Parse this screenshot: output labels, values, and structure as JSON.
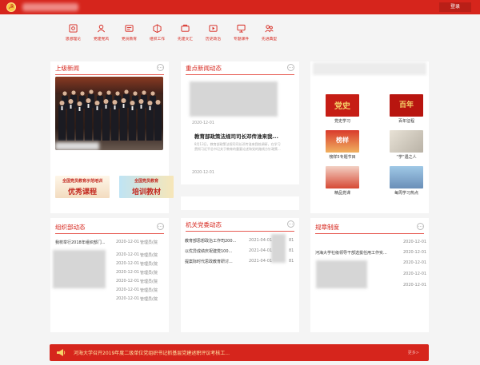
{
  "header": {
    "logo_icon": "party-emblem-icon",
    "login_label": "登录"
  },
  "nav": [
    {
      "label": "思想理论",
      "icon": "theory-icon"
    },
    {
      "label": "党建党风",
      "icon": "people-icon"
    },
    {
      "label": "党员教育",
      "icon": "education-icon"
    },
    {
      "label": "组织工作",
      "icon": "organization-icon"
    },
    {
      "label": "先建文汇",
      "icon": "culture-icon"
    },
    {
      "label": "历史政治",
      "icon": "history-icon"
    },
    {
      "label": "专题课件",
      "icon": "courseware-icon"
    },
    {
      "label": "先进典型",
      "icon": "model-icon"
    }
  ],
  "upper_news": {
    "title": "上级新闻",
    "banners": [
      {
        "line1": "全国党员教育示范培训",
        "line2": "优秀课程"
      },
      {
        "line1": "全国党员教育",
        "line2": "培训教材"
      }
    ]
  },
  "key_news": {
    "title": "重点新闻动态",
    "date_top": "2020-12-01",
    "headline": "教育部政策法规司司长邓传淮来我...",
    "summary": "8月13日，教育部政策法规司司长邓传淮来我校调研，在学习贯彻习近平总书记关于教育的重要论述和党的路线方针政策...",
    "date_bottom": "2020-12-01"
  },
  "topics": [
    {
      "label": "党史学习",
      "img_text": "党史"
    },
    {
      "label": "百年征程",
      "img_text": "百年"
    },
    {
      "label": "榜样5专题节目",
      "img_text": "榜样"
    },
    {
      "label": "“学”遇之人",
      "img_text": ""
    },
    {
      "label": "精品党课",
      "img_text": ""
    },
    {
      "label": "每周学习热点",
      "img_text": ""
    }
  ],
  "org_news": {
    "title": "组织部动态",
    "rows": [
      {
        "title": "我校举行2018年组织部门...",
        "date": "2020-12-01",
        "category": "管理员(院"
      },
      {
        "title": "",
        "date": "2020-12-01",
        "category": "管理员(院"
      },
      {
        "title": "",
        "date": "2020-12-01",
        "category": "管理员(院"
      },
      {
        "title": "",
        "date": "2020-12-01",
        "category": "管理员(院"
      },
      {
        "title": "",
        "date": "2020-12-01",
        "category": "管理员(院"
      },
      {
        "title": "",
        "date": "2020-12-01",
        "category": "管理员(院"
      },
      {
        "title": "",
        "date": "2020-12-01",
        "category": "管理员(院"
      }
    ]
  },
  "party_news": {
    "title": "机关党委动态",
    "rows": [
      {
        "title": "教育部思想政治工作司200...",
        "date": "2021-04-01",
        "category": "81"
      },
      {
        "title": "以优异成绩庆祝建党100...",
        "date": "2021-04-01",
        "category": "81"
      },
      {
        "title": "提案际时代思政教育研讨...",
        "date": "2021-04-01",
        "category": "81"
      }
    ]
  },
  "regulations": {
    "title": "规章制度",
    "rows": [
      {
        "title": "",
        "date": "2020-12-01"
      },
      {
        "title": "",
        "date": "2020-12-01"
      },
      {
        "title": "河海大学社级领导干部选拔任用工作实...",
        "date": "2020-12-01"
      },
      {
        "title": "",
        "date": "2020-12-01"
      },
      {
        "title": "",
        "date": "2020-12-01"
      }
    ]
  },
  "notice_bar": {
    "icon": "megaphone-icon",
    "text": "河海大学召开2019年度二级单位党组织书记抓基层党建述职评议考核工...",
    "more_label": "更多>"
  },
  "colors": {
    "brand_red": "#d6251c",
    "notice_text": "#ffe9a8"
  }
}
